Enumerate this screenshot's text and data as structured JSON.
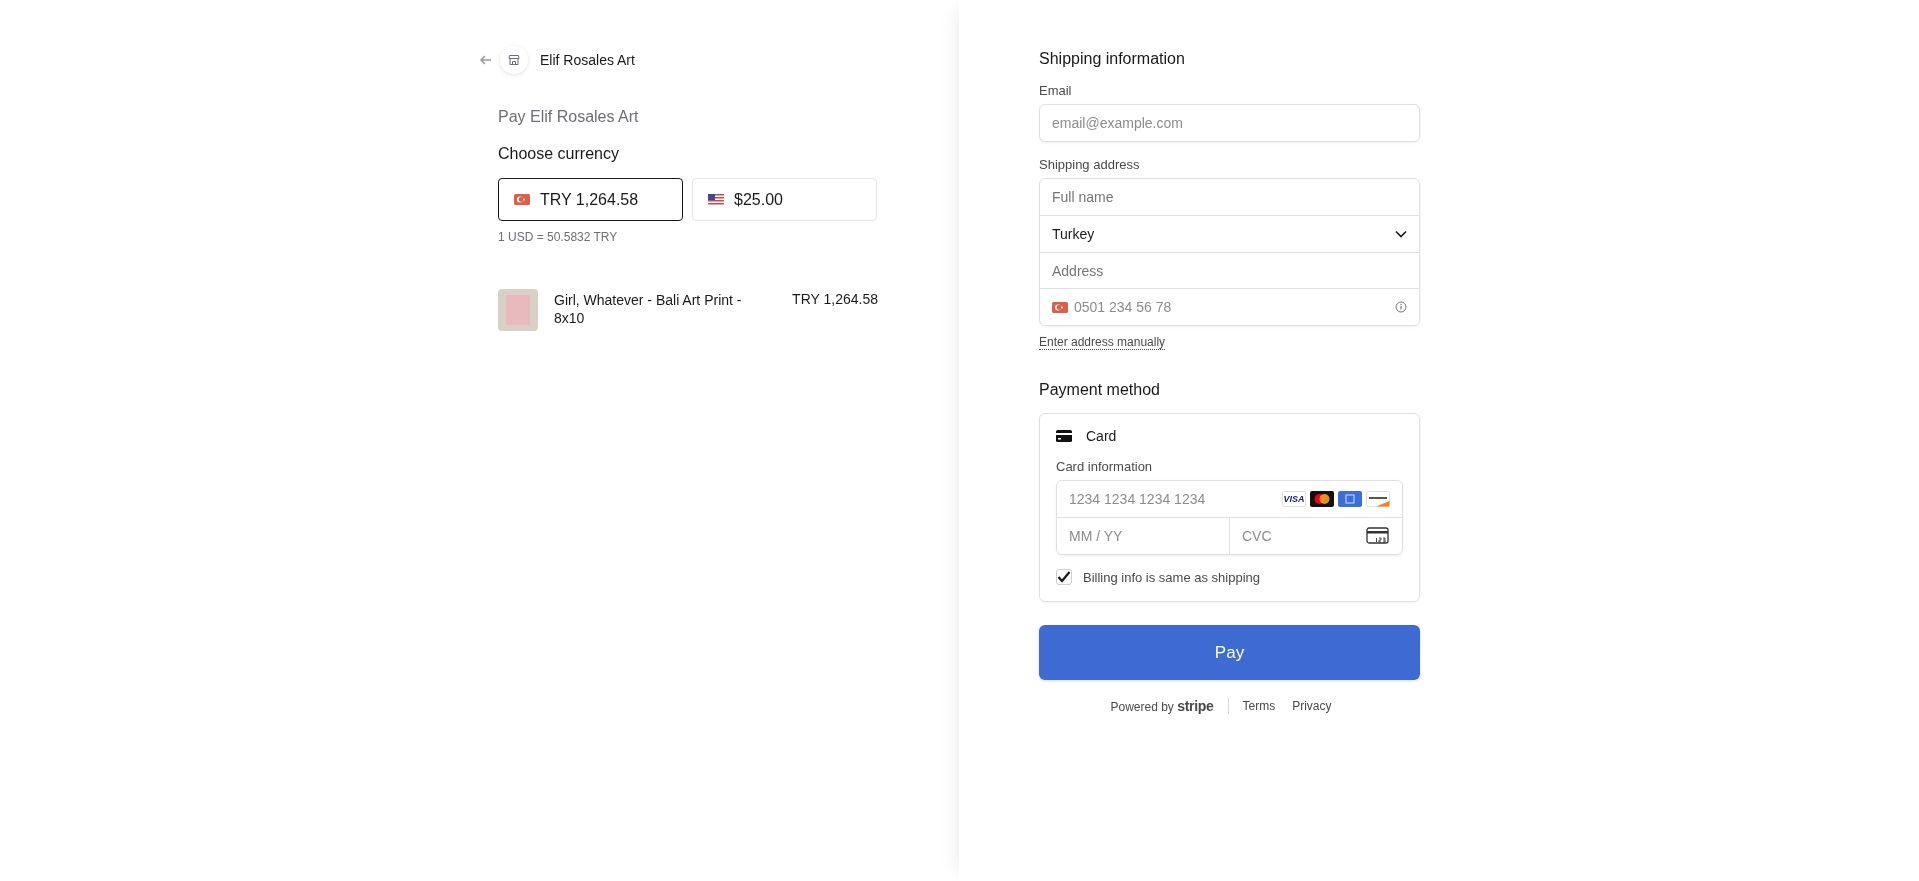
{
  "header": {
    "merchant": "Elif Rosales Art"
  },
  "summary": {
    "title": "Pay Elif Rosales Art",
    "currency_heading": "Choose currency",
    "currencies": [
      {
        "kind": "tr",
        "amount": "TRY 1,264.58",
        "selected": true
      },
      {
        "kind": "us",
        "amount": "$25.00",
        "selected": false
      }
    ],
    "rate": "1 USD = 50.5832 TRY",
    "items": [
      {
        "name": "Girl, Whatever - Bali Art Print - 8x10",
        "price": "TRY 1,264.58"
      }
    ]
  },
  "shipping": {
    "heading": "Shipping information",
    "email_label": "Email",
    "email_placeholder": "email@example.com",
    "address_label": "Shipping address",
    "name_placeholder": "Full name",
    "country": "Turkey",
    "address_placeholder": "Address",
    "phone": {
      "kind": "tr",
      "placeholder": "0501 234 56 78"
    },
    "manual_link": "Enter address manually"
  },
  "payment": {
    "heading": "Payment method",
    "method": "Card",
    "card_info_label": "Card information",
    "number_placeholder": "1234 1234 1234 1234",
    "brands": [
      {
        "kind": "visa",
        "text": "VISA"
      },
      {
        "kind": "mastercard"
      },
      {
        "kind": "amex"
      },
      {
        "kind": "discover"
      }
    ],
    "expiry_placeholder": "MM / YY",
    "cvc_placeholder": "CVC",
    "billing_same": {
      "label": "Billing info is same as shipping",
      "checked": true
    }
  },
  "pay_button": "Pay",
  "footer": {
    "powered_by": "Powered by",
    "brand": "stripe",
    "links": [
      "Terms",
      "Privacy"
    ]
  }
}
